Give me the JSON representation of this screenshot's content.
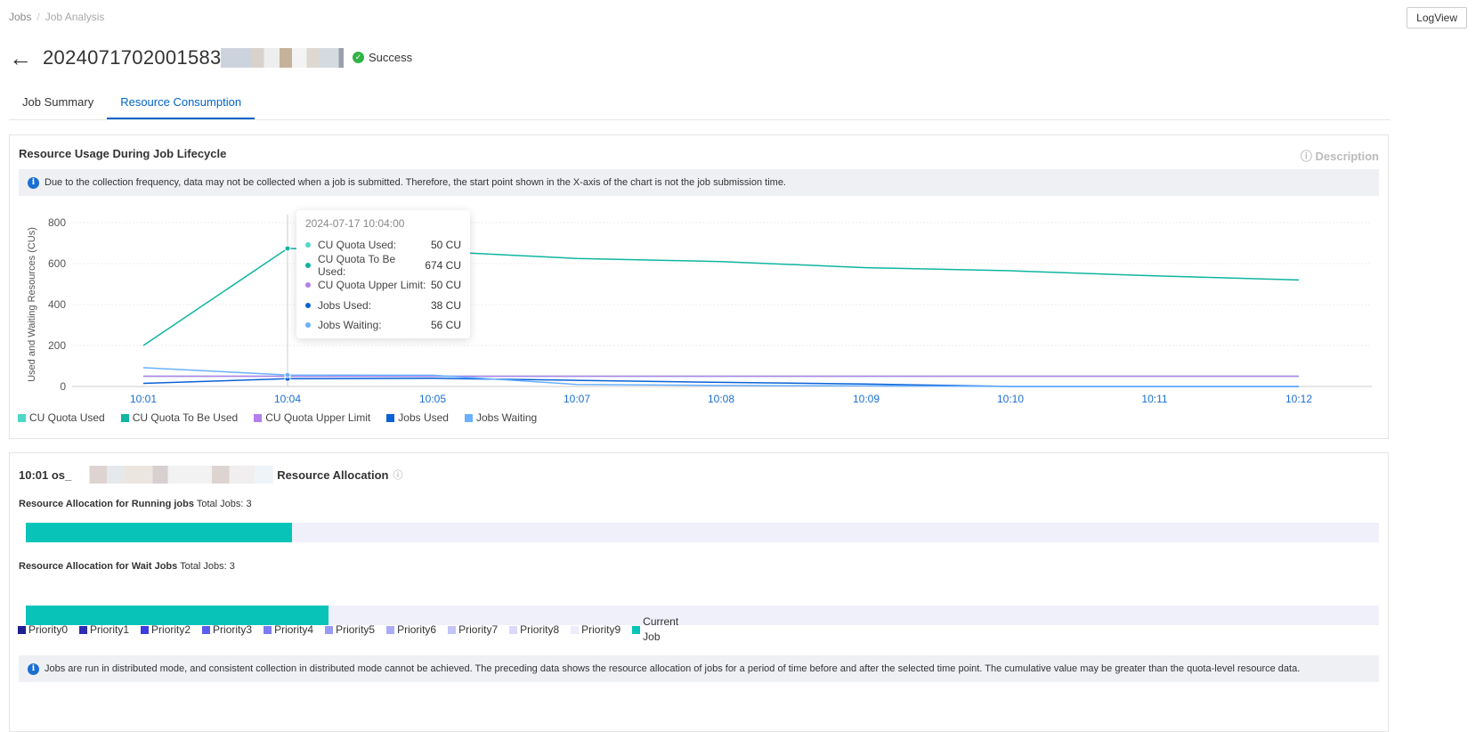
{
  "breadcrumb": {
    "items": [
      "Jobs",
      "Job Analysis"
    ]
  },
  "header": {
    "logview_label": "LogView",
    "job_id": "2024071702001583",
    "status": "Success"
  },
  "tabs": [
    {
      "label": "Job Summary"
    },
    {
      "label": "Resource Consumption",
      "active": true
    }
  ],
  "usage": {
    "title": "Resource Usage During Job Lifecycle",
    "description_label": "Description",
    "note": "Due to the collection frequency, data may not be collected when a job is submitted. Therefore, the start point shown in the X-axis of the chart is not the job submission time.",
    "tooltip": {
      "time": "2024-07-17 10:04:00",
      "rows": [
        {
          "label": "CU Quota Used:",
          "value": "50 CU"
        },
        {
          "label": "CU Quota To Be Used:",
          "value": "674 CU"
        },
        {
          "label": "CU Quota Upper Limit:",
          "value": "50 CU"
        },
        {
          "label": "Jobs Used:",
          "value": "38 CU"
        },
        {
          "label": "Jobs Waiting:",
          "value": "56 CU"
        }
      ]
    }
  },
  "chart_data": {
    "type": "line",
    "title": "Resource Usage During Job Lifecycle",
    "xlabel": "",
    "ylabel": "Used and Waiting Resources (CUs)",
    "x": [
      "10:01",
      "10:04",
      "10:05",
      "10:07",
      "10:08",
      "10:09",
      "10:10",
      "10:11",
      "10:12"
    ],
    "yticks": [
      "0",
      "200",
      "400",
      "600",
      "800"
    ],
    "ylim": [
      0,
      800
    ],
    "legend": "bottom-left",
    "grid": true,
    "series": [
      {
        "name": "CU Quota Used",
        "color": "#4fd8c8",
        "values": [
          50,
          50,
          50,
          50,
          50,
          50,
          50,
          50,
          50
        ]
      },
      {
        "name": "CU Quota To Be Used",
        "color": "#0fb5a0",
        "values": [
          200,
          674,
          660,
          625,
          610,
          580,
          565,
          540,
          520
        ]
      },
      {
        "name": "CU Quota Upper Limit",
        "color": "#b37feb",
        "values": [
          50,
          50,
          50,
          50,
          50,
          50,
          50,
          50,
          50
        ]
      },
      {
        "name": "Jobs Used",
        "color": "#0a62d6",
        "values": [
          15,
          38,
          40,
          30,
          20,
          12,
          0,
          0,
          0
        ]
      },
      {
        "name": "Jobs Waiting",
        "color": "#69b1ff",
        "values": [
          92,
          56,
          55,
          10,
          5,
          3,
          0,
          0,
          0
        ]
      }
    ]
  },
  "allocation": {
    "title_prefix": "10:01 os_",
    "title": "Resource Allocation",
    "running": {
      "label": "Resource Allocation for Running jobs",
      "total": "Total Jobs: 3",
      "current_job_fraction": 0.197
    },
    "wait": {
      "label": "Resource Allocation for Wait Jobs",
      "total": "Total Jobs: 3",
      "current_job_fraction": 0.224
    },
    "legend": [
      {
        "label": "Priority0",
        "color": "#1f1f8f"
      },
      {
        "label": "Priority1",
        "color": "#2d2db0"
      },
      {
        "label": "Priority2",
        "color": "#3c3ce0"
      },
      {
        "label": "Priority3",
        "color": "#5c5cf0"
      },
      {
        "label": "Priority4",
        "color": "#7b7bf5"
      },
      {
        "label": "Priority5",
        "color": "#9999f7"
      },
      {
        "label": "Priority6",
        "color": "#ababf7"
      },
      {
        "label": "Priority7",
        "color": "#c4c4f9"
      },
      {
        "label": "Priority8",
        "color": "#dadafb"
      },
      {
        "label": "Priority9",
        "color": "#ececfc"
      },
      {
        "label": "Current Job",
        "color": "#08c4b8"
      }
    ],
    "note": "Jobs are run in distributed mode, and consistent collection in distributed mode cannot be achieved. The preceding data shows the resource allocation of jobs for a period of time before and after the selected time point. The cumulative value may be greater than the quota-level resource data."
  }
}
